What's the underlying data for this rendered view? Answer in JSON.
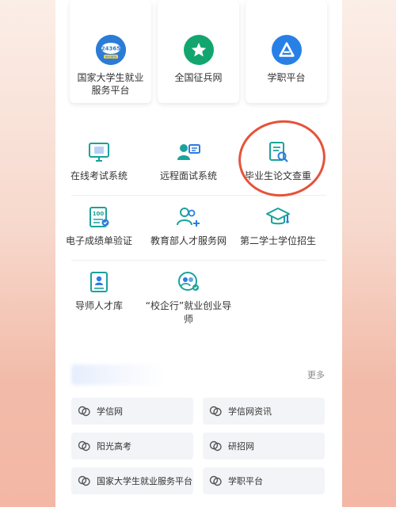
{
  "top_cards": [
    {
      "label": "国家大学生就业服务平台",
      "badge_top": "24365",
      "badge_bottom": "就业服务",
      "icon": "24365-logo-icon",
      "color": "#2b7cd6"
    },
    {
      "label": "全国征兵网",
      "icon": "star-icon",
      "color": "#12a66e"
    },
    {
      "label": "学职平台",
      "icon": "triangle-logo-icon",
      "color": "#2880e6"
    }
  ],
  "services": [
    {
      "label": "在线考试系统",
      "icon": "monitor-icon"
    },
    {
      "label": "远程面试系统",
      "icon": "interview-icon"
    },
    {
      "label": "毕业生论文查重",
      "icon": "document-search-icon"
    },
    {
      "label": "电子成绩单验证",
      "icon": "score-report-icon"
    },
    {
      "label": "教育部人才服务网",
      "icon": "people-add-icon"
    },
    {
      "label": "第二学士学位招生",
      "icon": "graduation-cap-icon"
    },
    {
      "label": "导师人才库",
      "icon": "mentor-database-icon"
    },
    {
      "label": "“校企行”就业创业导师",
      "icon": "mentor-group-icon"
    }
  ],
  "links_section": {
    "more_label": "更多",
    "links": [
      {
        "label": "学信网",
        "icon": "link-icon"
      },
      {
        "label": "学信网资讯",
        "icon": "link-icon"
      },
      {
        "label": "阳光高考",
        "icon": "link-icon"
      },
      {
        "label": "研招网",
        "icon": "link-icon"
      },
      {
        "label": "国家大学生就业服务平台",
        "icon": "link-icon"
      },
      {
        "label": "学职平台",
        "icon": "link-icon"
      }
    ]
  },
  "colors": {
    "accent": "#2a7de1",
    "highlight_circle": "#e5533a",
    "icon_teal": "#1aa39a"
  }
}
